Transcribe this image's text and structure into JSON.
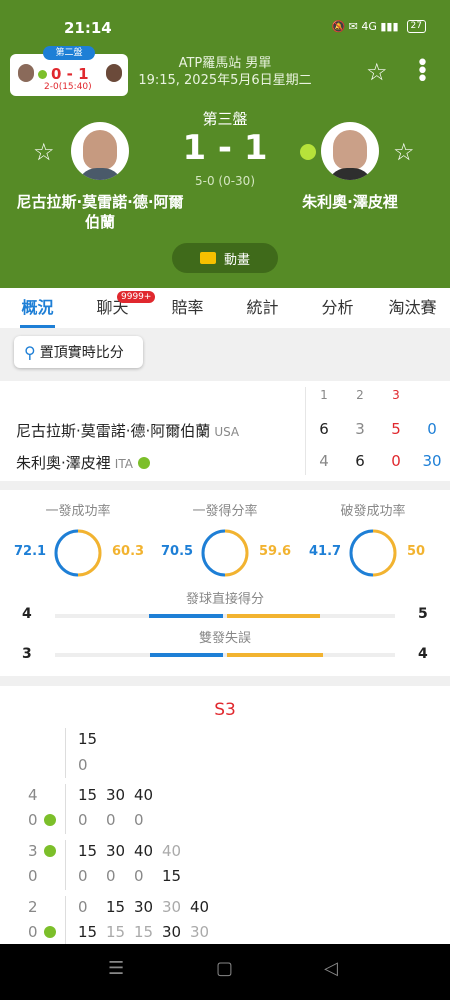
{
  "status": {
    "time": "21:14",
    "battery": "27",
    "icons": "🔕 ✉ 4G ▮▮▮"
  },
  "mini": {
    "tag": "第二盤",
    "score": "0 - 1",
    "sub": "2-0(15:40)"
  },
  "event": {
    "name": "ATP羅馬站 男單",
    "datetime": "19:15, 2025年5月6日星期二"
  },
  "current": {
    "set_label": "第三盤",
    "score": "1 - 1",
    "game": "5-0 (0-30)"
  },
  "players": {
    "p1": {
      "name": "尼古拉斯·莫雷諾·德·阿爾伯蘭",
      "short": "尼古拉斯·莫雷諾·德·阿爾伯蘭",
      "country": "USA"
    },
    "p2": {
      "name": "朱利奧·澤皮裡",
      "short": "朱利奧·澤皮裡",
      "country": "ITA"
    }
  },
  "animation_label": "動畫",
  "tabs": [
    {
      "label": "概況"
    },
    {
      "label": "聊天",
      "badge": "9999+"
    },
    {
      "label": "賠率"
    },
    {
      "label": "統計"
    },
    {
      "label": "分析"
    },
    {
      "label": "淘汰賽"
    }
  ],
  "pin_label": "置頂實時比分",
  "scoreboard": {
    "headers": [
      "1",
      "2",
      "3"
    ],
    "p1": [
      "6",
      "3",
      "5",
      "0"
    ],
    "p2": [
      "4",
      "6",
      "0",
      "30"
    ]
  },
  "stats": [
    {
      "title": "一發成功率",
      "p1": "72.1",
      "p2": "60.3"
    },
    {
      "title": "一發得分率",
      "p1": "70.5",
      "p2": "59.6"
    },
    {
      "title": "破發成功率",
      "p1": "41.7",
      "p2": "50"
    }
  ],
  "bars": [
    {
      "title": "發球直接得分",
      "p1": "4",
      "p2": "5"
    },
    {
      "title": "雙發失誤",
      "p1": "3",
      "p2": "4"
    }
  ],
  "pbp": {
    "set": "S3",
    "rows": [
      {
        "game_top": "",
        "game_bot": "",
        "top": [
          "15"
        ],
        "bot": [
          "0"
        ]
      },
      {
        "game_top": "4",
        "game_bot": "0",
        "top": [
          "15",
          "30",
          "40"
        ],
        "bot": [
          "0",
          "0",
          "0"
        ]
      },
      {
        "game_top": "3",
        "game_bot": "0",
        "top": [
          "15",
          "30",
          "40",
          "40"
        ],
        "bot": [
          "0",
          "0",
          "0",
          "15"
        ]
      },
      {
        "game_top": "2",
        "game_bot": "0",
        "top": [
          "0",
          "15",
          "30",
          "30",
          "40"
        ],
        "bot": [
          "15",
          "15",
          "15",
          "30",
          "30"
        ]
      }
    ]
  },
  "colors": {
    "green": "#568b26",
    "blue": "#1e7fd6",
    "yellow": "#f2b330",
    "red": "#e0282e"
  }
}
